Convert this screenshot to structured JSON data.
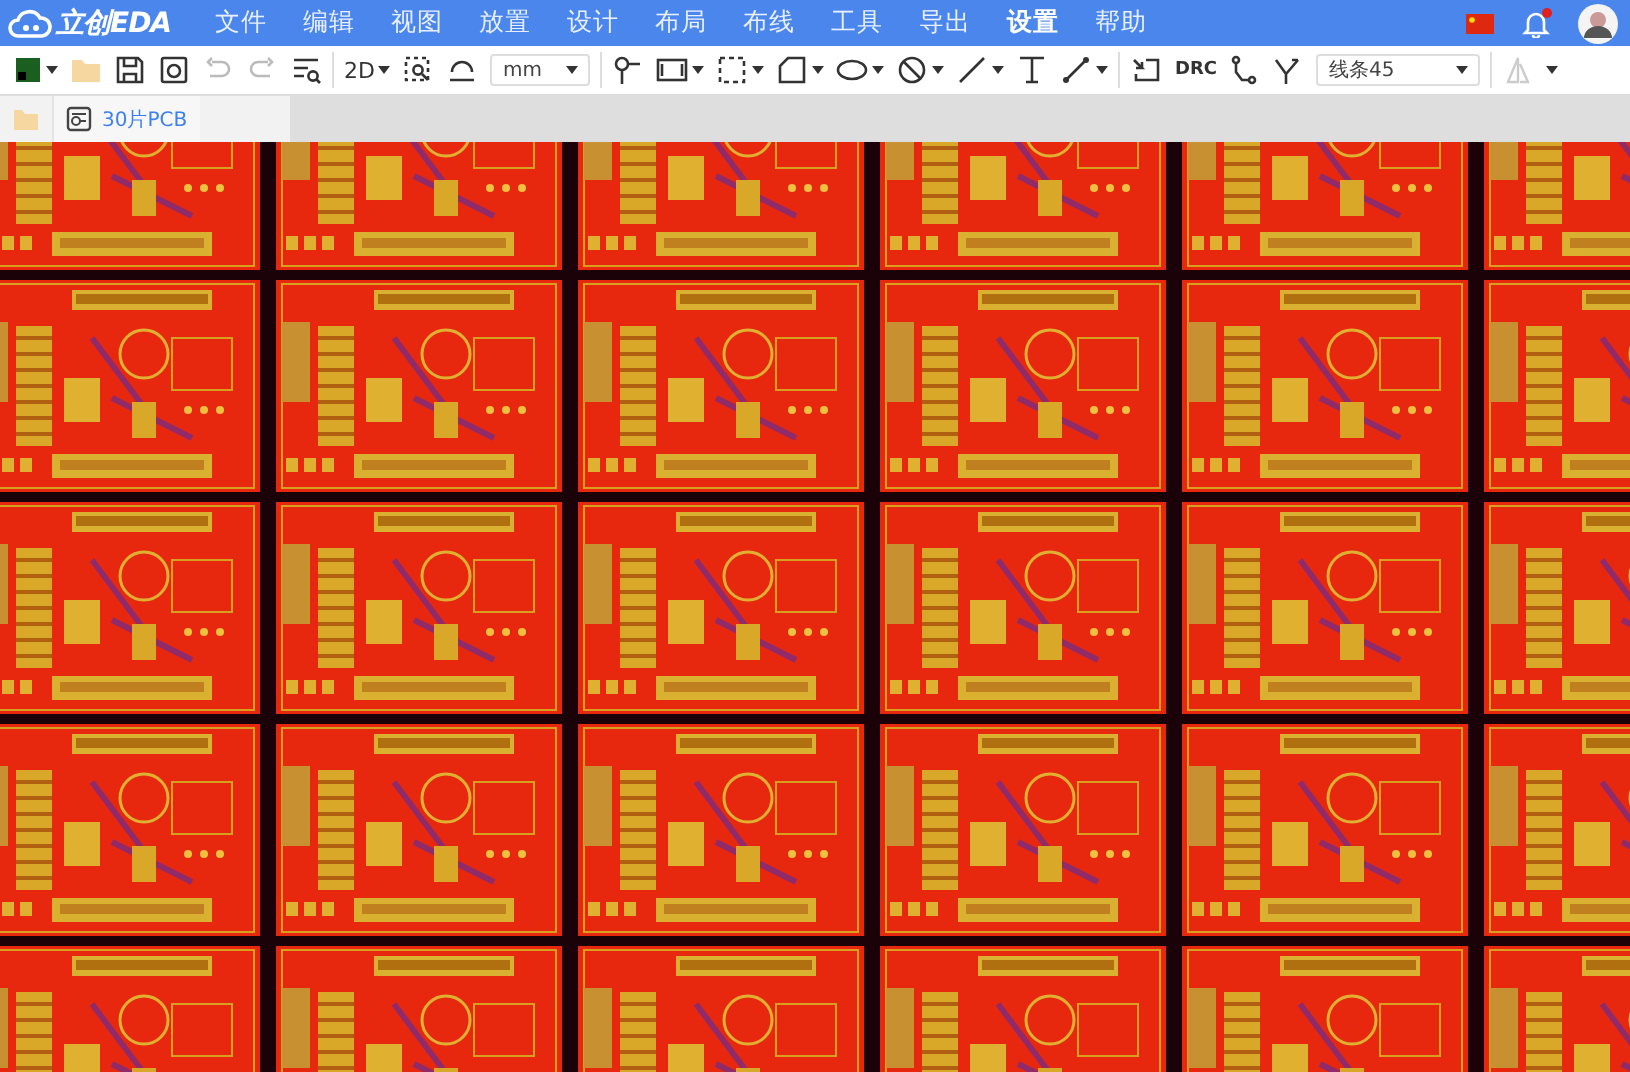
{
  "app": {
    "logo": "立创EDA"
  },
  "menu": [
    {
      "label": "文件",
      "selected": false
    },
    {
      "label": "编辑",
      "selected": false
    },
    {
      "label": "视图",
      "selected": false
    },
    {
      "label": "放置",
      "selected": false
    },
    {
      "label": "设计",
      "selected": false
    },
    {
      "label": "布局",
      "selected": false
    },
    {
      "label": "布线",
      "selected": false
    },
    {
      "label": "工具",
      "selected": false
    },
    {
      "label": "导出",
      "selected": false
    },
    {
      "label": "设置",
      "selected": true
    },
    {
      "label": "帮助",
      "selected": false
    }
  ],
  "notifications": {
    "unread": true
  },
  "toolbar": {
    "undo": {
      "disabled": true
    },
    "redo": {
      "disabled": true
    },
    "view_mode": "2D",
    "unit": "mm",
    "drc": "DRC",
    "route_mode": "线条45"
  },
  "tabs": [
    {
      "label": "30片PCB",
      "selected": true
    }
  ]
}
